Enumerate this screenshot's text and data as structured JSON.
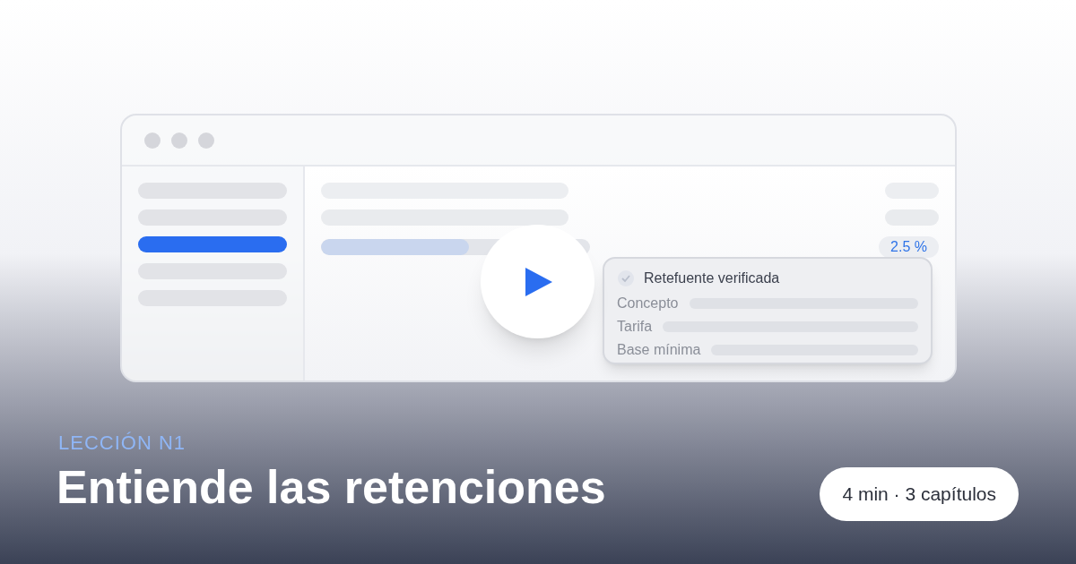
{
  "sidebar": {
    "items": [
      {
        "selected": false
      },
      {
        "selected": false
      },
      {
        "selected": true
      },
      {
        "selected": false
      },
      {
        "selected": false
      }
    ]
  },
  "main": {
    "progress": {
      "level": 0.55
    },
    "rate_badge": "2.5 %"
  },
  "card": {
    "title": "Retefuente verificada",
    "verified": true,
    "rows": [
      {
        "label": "Concepto"
      },
      {
        "label": "Tarifa"
      },
      {
        "label": "Base mínima"
      }
    ]
  },
  "lesson": {
    "eyebrow": "LECCIÓN N1",
    "title": "Entiende las retenciones",
    "meta": "4 min · 3 capítulos"
  }
}
